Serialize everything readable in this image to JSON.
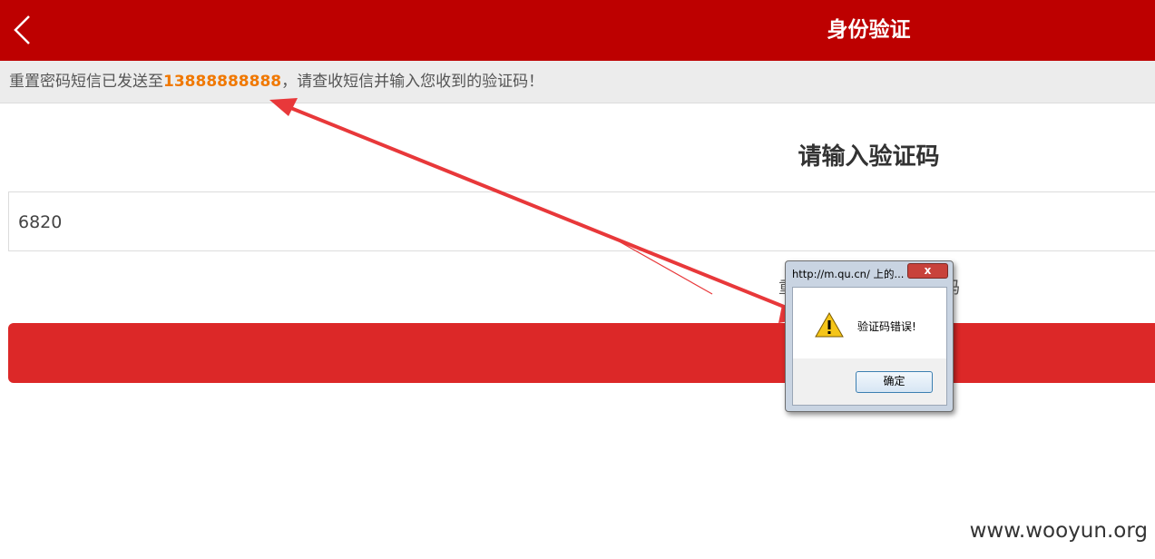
{
  "header": {
    "title": "身份验证",
    "back_icon": "chevron-left-icon"
  },
  "notice": {
    "prefix": "重置密码短信已发送至",
    "phone": "13888888888",
    "suffix": "，请查收短信并输入您收到的验证码！"
  },
  "form": {
    "title": "请输入验证码",
    "code_value": "6820",
    "resend_partial_start": "重",
    "resend_partial_end": "码"
  },
  "dialog": {
    "title": "http://m.qu.cn/ 上的...",
    "close_label": "x",
    "message": "验证码错误!",
    "ok_label": "确定",
    "icon": "warning-icon"
  },
  "watermark": "www.wooyun.org",
  "colors": {
    "header_bg": "#bd0000",
    "submit_bg": "#dc2828",
    "phone_highlight": "#f07800",
    "annotation_arrow": "#e8383a"
  }
}
